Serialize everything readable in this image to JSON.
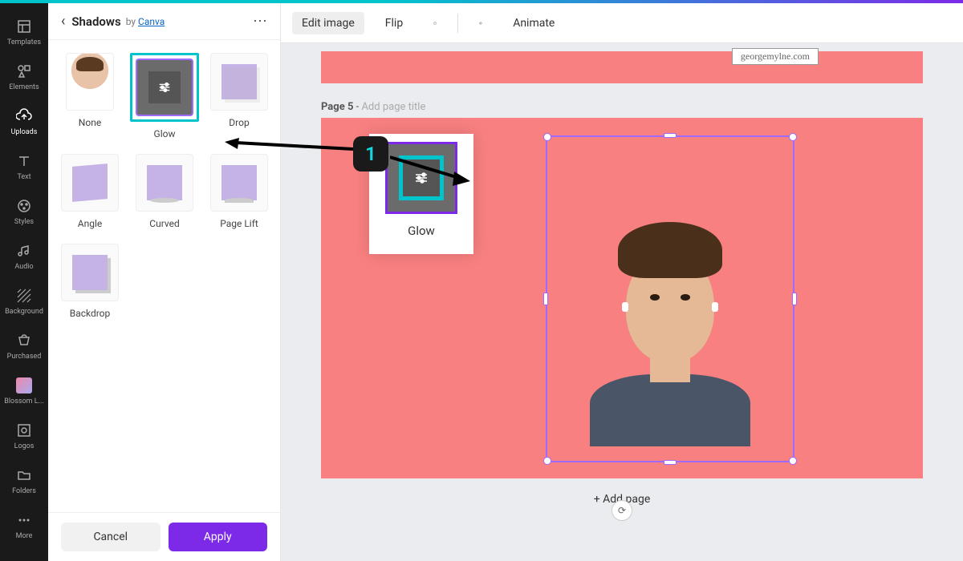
{
  "rail": [
    {
      "label": "Templates",
      "icon": "templates"
    },
    {
      "label": "Elements",
      "icon": "elements"
    },
    {
      "label": "Uploads",
      "icon": "uploads",
      "active": true
    },
    {
      "label": "Text",
      "icon": "text"
    },
    {
      "label": "Styles",
      "icon": "styles"
    },
    {
      "label": "Audio",
      "icon": "audio"
    },
    {
      "label": "Background",
      "icon": "background"
    },
    {
      "label": "Purchased",
      "icon": "purchased"
    },
    {
      "label": "Blossom L...",
      "icon": "blossom"
    },
    {
      "label": "Logos",
      "icon": "logos"
    },
    {
      "label": "Folders",
      "icon": "folders"
    },
    {
      "label": "More",
      "icon": "more"
    }
  ],
  "panel": {
    "title": "Shadows",
    "by_prefix": "by ",
    "by_link": "Canva",
    "tiles": [
      {
        "key": "none",
        "label": "None"
      },
      {
        "key": "glow",
        "label": "Glow",
        "selected": true
      },
      {
        "key": "drop",
        "label": "Drop"
      },
      {
        "key": "angle",
        "label": "Angle"
      },
      {
        "key": "curved",
        "label": "Curved"
      },
      {
        "key": "pagelift",
        "label": "Page Lift"
      },
      {
        "key": "backdrop",
        "label": "Backdrop"
      }
    ],
    "cancel": "Cancel",
    "apply": "Apply"
  },
  "toolbar": {
    "edit_image": "Edit image",
    "flip": "Flip",
    "animate": "Animate"
  },
  "page": {
    "prefix": "Page 5",
    "sep": " - ",
    "placeholder": "Add page title",
    "site": "georgemylne.com",
    "glow": "Glow",
    "addpage": "+ Add page"
  },
  "annot": {
    "num": "1"
  }
}
